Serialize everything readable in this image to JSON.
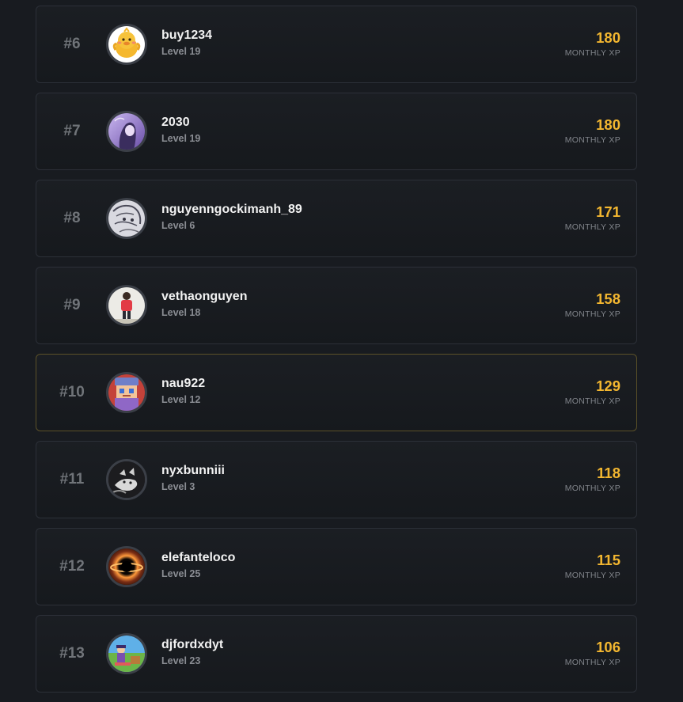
{
  "leaderboard": {
    "xp_label": "MONTHLY XP",
    "entries": [
      {
        "rank": "#6",
        "username": "buy1234",
        "level": "Level 19",
        "xp": "180",
        "avatar": "duck-avatar"
      },
      {
        "rank": "#7",
        "username": "2030",
        "level": "Level 19",
        "xp": "180",
        "avatar": "anime-girl-avatar"
      },
      {
        "rank": "#8",
        "username": "nguyenngockimanh_89",
        "level": "Level 6",
        "xp": "171",
        "avatar": "sketch-avatar"
      },
      {
        "rank": "#9",
        "username": "vethaonguyen",
        "level": "Level 18",
        "xp": "158",
        "avatar": "person-red-shirt-avatar"
      },
      {
        "rank": "#10",
        "username": "nau922",
        "level": "Level 12",
        "xp": "129",
        "avatar": "pixel-character-avatar",
        "highlighted": true
      },
      {
        "rank": "#11",
        "username": "nyxbunniii",
        "level": "Level 3",
        "xp": "118",
        "avatar": "monochrome-cat-avatar"
      },
      {
        "rank": "#12",
        "username": "elefanteloco",
        "level": "Level 25",
        "xp": "115",
        "avatar": "black-hole-avatar"
      },
      {
        "rank": "#13",
        "username": "djfordxdyt",
        "level": "Level 23",
        "xp": "106",
        "avatar": "cartoon-field-avatar"
      }
    ]
  }
}
